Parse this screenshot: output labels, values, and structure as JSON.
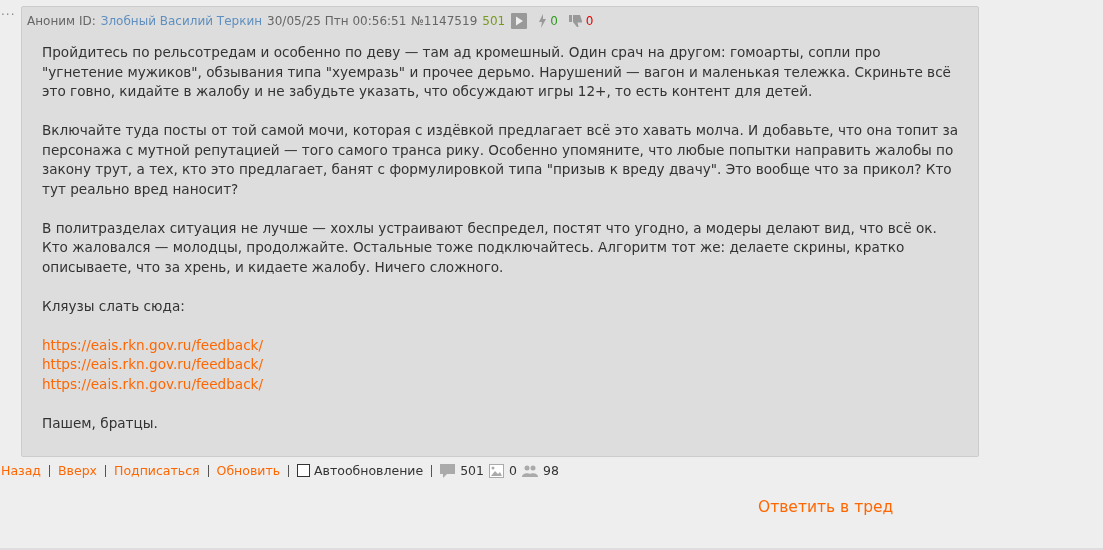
{
  "post": {
    "menu": "...",
    "author": "Аноним",
    "id_label": "ID:",
    "id_name": "Злобный Василий Теркин",
    "date": "30/05/25 Птн 00:56:51",
    "number": "№1147519",
    "reply_count": "501",
    "likes": "0",
    "dislikes": "0",
    "paragraphs": [
      {
        "kind": "text",
        "lines": [
          "Пройдитесь по рельсотредам и особенно по деву — там ад кромешный. Один срач на другом: гомоарты, сопли про \"угнетение мужиков\", обзывания типа \"хуемразь\" и прочее дерьмо. Нарушений — вагон и маленькая тележка. Скриньте всё это говно, кидайте в жалобу и не забудьте указать, что обсуждают игры 12+, то есть контент для детей."
        ]
      },
      {
        "kind": "text",
        "lines": [
          "Включайте туда посты от той самой мочи, которая с издёвкой предлагает всё это хавать молча. И добавьте, что она топит за персонажа с мутной репутацией — того самого транса рику. Особенно упомяните, что любые попытки направить жалобы по закону трут, а тех, кто это предлагает, банят с формулировкой типа \"призыв к вреду двачу\". Это вообще что за прикол? Кто тут реально вред наносит?"
        ]
      },
      {
        "kind": "text",
        "lines": [
          "В политразделах ситуация не лучше — хохлы устраивают беспредел, постят что угодно, а модеры делают вид, что всё ок. Кто жаловался — молодцы, продолжайте. Остальные тоже подключайтесь. Алгоритм тот же: делаете скрины, кратко описываете, что за хрень, и кидаете жалобу. Ничего сложного."
        ]
      },
      {
        "kind": "text",
        "lines": [
          "Кляузы слать сюда:"
        ]
      },
      {
        "kind": "links",
        "lines": [
          "https://eais.rkn.gov.ru/feedback/",
          "https://eais.rkn.gov.ru/feedback/",
          "https://eais.rkn.gov.ru/feedback/"
        ]
      },
      {
        "kind": "text",
        "lines": [
          "Пашем, братцы."
        ]
      }
    ]
  },
  "footer": {
    "links": [
      "Назад",
      "Вверх",
      "Подписаться",
      "Обновить"
    ],
    "auto_update": {
      "label": "Автообновление",
      "checked": false
    },
    "posts": "501",
    "images": "0",
    "posters": "98"
  },
  "reply_button": "Ответить в тред"
}
